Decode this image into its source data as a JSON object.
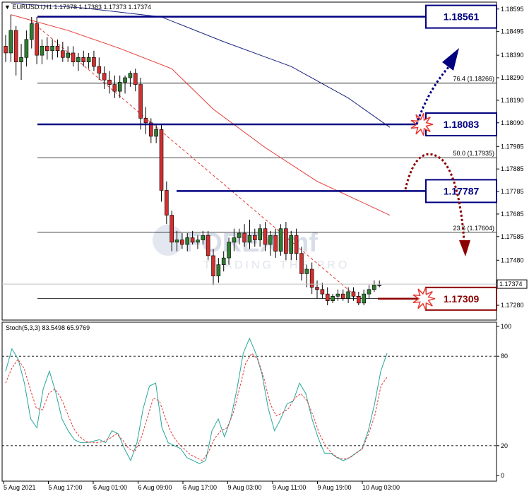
{
  "chart_data": [
    {
      "type": "candlestick",
      "symbol_header": "EURUSD.i,H1  1.17378 1.17383 1.17373 1.17374",
      "ylim": [
        1.1723,
        1.1861
      ],
      "price_ticks": [
        "1.18595",
        "1.18495",
        "1.18390",
        "1.18290",
        "1.18190",
        "1.18090",
        "1.17985",
        "1.17885",
        "1.17785",
        "1.17685",
        "1.17585",
        "1.17480",
        "1.17380",
        "1.17280"
      ],
      "current_price": "1.17374",
      "time_labels": [
        "5 Aug 2021",
        "5 Aug 17:00",
        "6 Aug 01:00",
        "6 Aug 09:00",
        "6 Aug 17:00",
        "9 Aug 03:00",
        "9 Aug 11:00",
        "9 Aug 19:00",
        "10 Aug 03:00"
      ],
      "candles": [
        [
          1.1843,
          1.1848,
          1.1836,
          1.184
        ],
        [
          1.184,
          1.1857,
          1.1836,
          1.185
        ],
        [
          1.185,
          1.1852,
          1.183,
          1.1836
        ],
        [
          1.1836,
          1.1844,
          1.1828,
          1.1838
        ],
        [
          1.1838,
          1.185,
          1.1834,
          1.1846
        ],
        [
          1.1846,
          1.1856,
          1.1842,
          1.1853
        ],
        [
          1.1853,
          1.1856,
          1.1835,
          1.1839
        ],
        [
          1.1839,
          1.1846,
          1.1835,
          1.1843
        ],
        [
          1.1843,
          1.1847,
          1.1837,
          1.1841
        ],
        [
          1.1841,
          1.1846,
          1.1837,
          1.1843
        ],
        [
          1.1843,
          1.1846,
          1.1838,
          1.1841
        ],
        [
          1.1841,
          1.1845,
          1.1836,
          1.1838
        ],
        [
          1.1838,
          1.1843,
          1.1836,
          1.184
        ],
        [
          1.184,
          1.1843,
          1.1834,
          1.1836
        ],
        [
          1.1836,
          1.184,
          1.1832,
          1.1838
        ],
        [
          1.1838,
          1.1841,
          1.1834,
          1.1836
        ],
        [
          1.1836,
          1.184,
          1.1833,
          1.1838
        ],
        [
          1.1838,
          1.1841,
          1.1832,
          1.1834
        ],
        [
          1.1834,
          1.1838,
          1.1828,
          1.1831
        ],
        [
          1.1831,
          1.1834,
          1.1824,
          1.1828
        ],
        [
          1.1828,
          1.1832,
          1.1822,
          1.1826
        ],
        [
          1.1826,
          1.183,
          1.182,
          1.1823
        ],
        [
          1.1823,
          1.183,
          1.182,
          1.1827
        ],
        [
          1.1827,
          1.183,
          1.1822,
          1.1829
        ],
        [
          1.1829,
          1.1832,
          1.1825,
          1.1831
        ],
        [
          1.1831,
          1.1833,
          1.1823,
          1.1826
        ],
        [
          1.1826,
          1.1829,
          1.1806,
          1.1811
        ],
        [
          1.1811,
          1.1816,
          1.1804,
          1.1809
        ],
        [
          1.1809,
          1.1811,
          1.18,
          1.1803
        ],
        [
          1.1803,
          1.1808,
          1.18,
          1.1806
        ],
        [
          1.1806,
          1.1808,
          1.1774,
          1.1779
        ],
        [
          1.1779,
          1.1783,
          1.1764,
          1.1768
        ],
        [
          1.1768,
          1.177,
          1.1752,
          1.1756
        ],
        [
          1.1756,
          1.1761,
          1.1752,
          1.1757
        ],
        [
          1.1757,
          1.176,
          1.1753,
          1.1755
        ],
        [
          1.1755,
          1.176,
          1.1752,
          1.1758
        ],
        [
          1.1758,
          1.1761,
          1.1755,
          1.1756
        ],
        [
          1.1756,
          1.1759,
          1.1753,
          1.1757
        ],
        [
          1.1757,
          1.1761,
          1.1755,
          1.1759
        ],
        [
          1.1759,
          1.1761,
          1.1748,
          1.175
        ],
        [
          1.175,
          1.1753,
          1.1737,
          1.1741
        ],
        [
          1.1741,
          1.1749,
          1.1738,
          1.1746
        ],
        [
          1.1746,
          1.1752,
          1.1743,
          1.1749
        ],
        [
          1.1749,
          1.1758,
          1.1746,
          1.1756
        ],
        [
          1.1756,
          1.1762,
          1.1752,
          1.1758
        ],
        [
          1.1758,
          1.1762,
          1.1755,
          1.176
        ],
        [
          1.176,
          1.1764,
          1.1754,
          1.1756
        ],
        [
          1.1756,
          1.1766,
          1.1753,
          1.1759
        ],
        [
          1.1759,
          1.1762,
          1.1754,
          1.1757
        ],
        [
          1.1757,
          1.1764,
          1.1754,
          1.1762
        ],
        [
          1.1762,
          1.1765,
          1.1752,
          1.1755
        ],
        [
          1.1755,
          1.1761,
          1.175,
          1.1759
        ],
        [
          1.1759,
          1.1762,
          1.1749,
          1.1752
        ],
        [
          1.1752,
          1.1764,
          1.175,
          1.1762
        ],
        [
          1.1762,
          1.1765,
          1.1748,
          1.1751
        ],
        [
          1.1751,
          1.1761,
          1.1748,
          1.1759
        ],
        [
          1.1759,
          1.1762,
          1.1748,
          1.1751
        ],
        [
          1.1751,
          1.1754,
          1.1739,
          1.1742
        ],
        [
          1.1742,
          1.1746,
          1.1736,
          1.1744
        ],
        [
          1.1744,
          1.1747,
          1.1733,
          1.1736
        ],
        [
          1.1736,
          1.1739,
          1.1731,
          1.1735
        ],
        [
          1.1735,
          1.1738,
          1.1731,
          1.1733
        ],
        [
          1.1733,
          1.1736,
          1.1728,
          1.173
        ],
        [
          1.173,
          1.1733,
          1.1729,
          1.1732
        ],
        [
          1.1732,
          1.1735,
          1.173,
          1.1733
        ],
        [
          1.1733,
          1.1735,
          1.173,
          1.1731
        ],
        [
          1.1731,
          1.1736,
          1.1729,
          1.1734
        ],
        [
          1.1734,
          1.1736,
          1.173,
          1.1732
        ],
        [
          1.1732,
          1.1734,
          1.1728,
          1.1729
        ],
        [
          1.1729,
          1.1735,
          1.1728,
          1.1733
        ],
        [
          1.1733,
          1.1737,
          1.1731,
          1.1735
        ],
        [
          1.1735,
          1.1739,
          1.1734,
          1.1737
        ],
        [
          1.1737,
          1.1739,
          1.1736,
          1.1737
        ]
      ],
      "ma_blue": [
        [
          1,
          1.1862
        ],
        [
          15,
          1.186
        ],
        [
          30,
          1.1856
        ],
        [
          42,
          1.1845
        ],
        [
          55,
          1.1834
        ],
        [
          66,
          1.182
        ],
        [
          74,
          1.1807
        ]
      ],
      "ma_red": [
        [
          1,
          1.1857
        ],
        [
          12,
          1.185
        ],
        [
          22,
          1.1842
        ],
        [
          32,
          1.1833
        ],
        [
          40,
          1.1815
        ],
        [
          50,
          1.1798
        ],
        [
          60,
          1.1783
        ],
        [
          74,
          1.1768
        ]
      ],
      "trendline": [
        [
          5,
          1.1854
        ],
        [
          68,
          1.1731
        ]
      ],
      "fib_levels": [
        {
          "label": "76.4 (1.18266)",
          "price": 1.18266
        },
        {
          "label": "50.0 (1.17935)",
          "price": 1.17935
        },
        {
          "label": "23.6 (1.17604)",
          "price": 1.17604
        }
      ],
      "fib_base_price": 1.1731,
      "key_levels": [
        {
          "label": "1.18561",
          "price": 1.18561,
          "color": "#000080"
        },
        {
          "label": "1.18083",
          "price": 1.18083,
          "color": "#000080"
        },
        {
          "label": "1.17787",
          "price": 1.17787,
          "color": "#000080"
        },
        {
          "label": "1.17309",
          "price": 1.17309,
          "color": "#8b0000"
        }
      ]
    },
    {
      "type": "line",
      "title": "Stoch(5,3,3) 83.5498 65.9769",
      "ylim": [
        0,
        100
      ],
      "y_ticks": [
        "100",
        "80",
        "20",
        "0"
      ],
      "levels": [
        80,
        20
      ],
      "series": [
        {
          "values": [
            70,
            85,
            78,
            62,
            38,
            32,
            58,
            70,
            56,
            38,
            30,
            24,
            22,
            22,
            23,
            24,
            22,
            30,
            28,
            18,
            10,
            22,
            45,
            60,
            62,
            32,
            22,
            20,
            18,
            12,
            10,
            8,
            10,
            30,
            38,
            26,
            38,
            58,
            82,
            92,
            82,
            68,
            45,
            30,
            38,
            48,
            50,
            62,
            55,
            38,
            25,
            15,
            15,
            12,
            10,
            12,
            15,
            18,
            30,
            48,
            70,
            82
          ]
        },
        {
          "values": [
            62,
            72,
            78,
            72,
            58,
            45,
            44,
            55,
            58,
            52,
            42,
            32,
            26,
            23,
            22,
            22,
            23,
            25,
            28,
            24,
            18,
            16,
            25,
            38,
            52,
            50,
            38,
            28,
            22,
            18,
            14,
            12,
            10,
            16,
            25,
            30,
            32,
            42,
            58,
            75,
            82,
            78,
            65,
            48,
            40,
            42,
            45,
            52,
            55,
            50,
            40,
            28,
            20,
            15,
            12,
            11,
            12,
            15,
            18,
            28,
            40,
            60,
            66
          ]
        }
      ]
    }
  ],
  "colors": {
    "bull": "#2e7d32",
    "bear": "#d32f2f",
    "ma_blue": "#1a237e",
    "ma_red": "#e53935",
    "trend": "#e53935",
    "stoch_main": "#26a69a",
    "stoch_signal": "#e53935",
    "arrow_up": "#000080",
    "arrow_down": "#8b0000"
  },
  "watermark": {
    "brand": "FOREXimf",
    "tagline": "TRADING THE PRO"
  }
}
